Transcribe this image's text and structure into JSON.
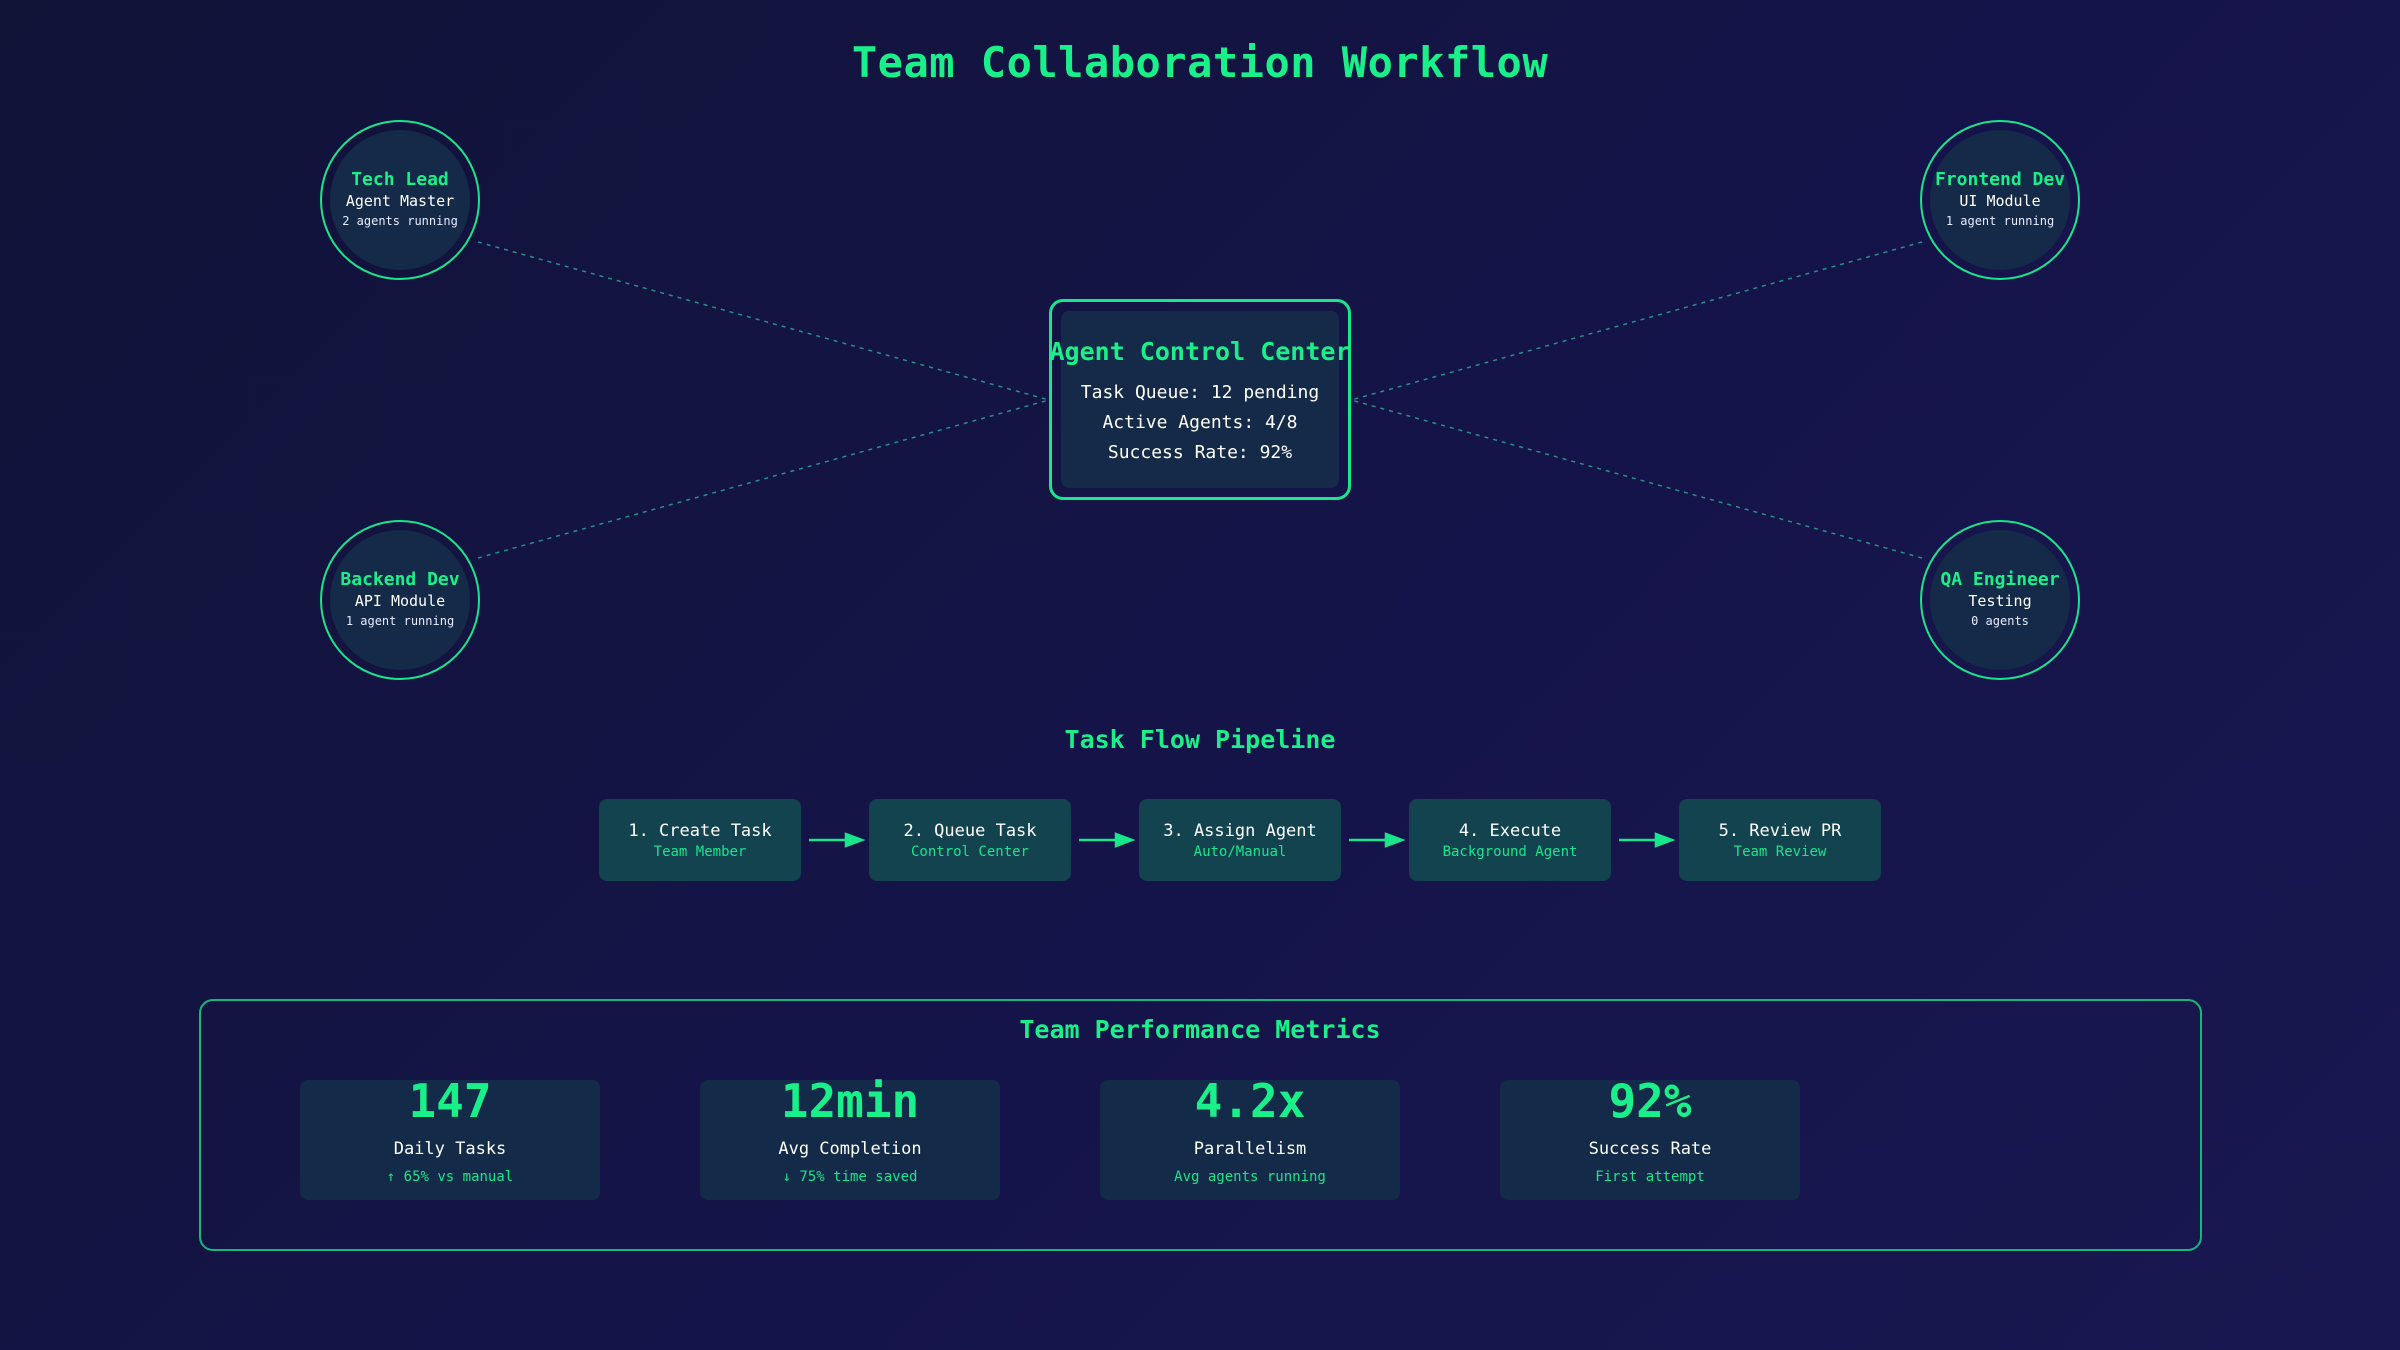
{
  "title": "Team Collaboration Workflow",
  "colors": {
    "accent": "#19f08a",
    "panel": "#142a48",
    "step": "#12434f",
    "background": "#13143f"
  },
  "team": [
    {
      "name": "Tech Lead",
      "role": "Agent Master",
      "status": "2 agents running"
    },
    {
      "name": "Frontend Dev",
      "role": "UI Module",
      "status": "1 agent running"
    },
    {
      "name": "Backend Dev",
      "role": "API Module",
      "status": "1 agent running"
    },
    {
      "name": "QA Engineer",
      "role": "Testing",
      "status": "0 agents"
    }
  ],
  "control_center": {
    "title": "Agent Control Center",
    "lines": [
      "Task Queue: 12 pending",
      "Active Agents: 4/8",
      "Success Rate: 92%"
    ]
  },
  "pipeline": {
    "title": "Task Flow Pipeline",
    "steps": [
      {
        "label": "1. Create Task",
        "sub": "Team Member"
      },
      {
        "label": "2. Queue Task",
        "sub": "Control Center"
      },
      {
        "label": "3. Assign Agent",
        "sub": "Auto/Manual"
      },
      {
        "label": "4. Execute",
        "sub": "Background Agent"
      },
      {
        "label": "5. Review PR",
        "sub": "Team Review"
      }
    ]
  },
  "metrics": {
    "title": "Team Performance Metrics",
    "items": [
      {
        "value": "147",
        "label": "Daily Tasks",
        "sub": "↑ 65% vs manual"
      },
      {
        "value": "12min",
        "label": "Avg Completion",
        "sub": "↓ 75% time saved"
      },
      {
        "value": "4.2x",
        "label": "Parallelism",
        "sub": "Avg agents running"
      },
      {
        "value": "92%",
        "label": "Success Rate",
        "sub": "First attempt"
      }
    ]
  }
}
